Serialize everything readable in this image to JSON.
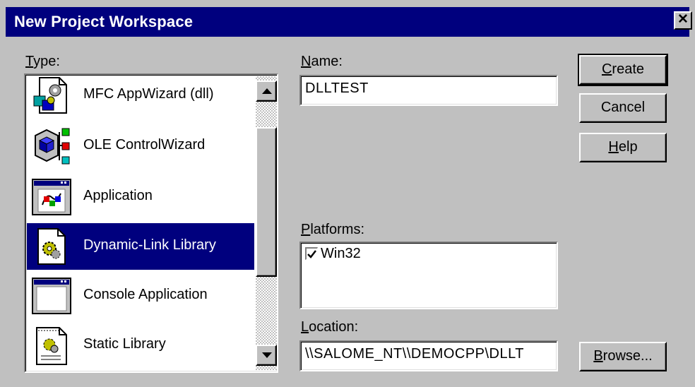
{
  "window": {
    "title": "New Project Workspace",
    "close_glyph": "✕"
  },
  "type_label": {
    "accel": "T",
    "rest": "ype:"
  },
  "type_list": {
    "items": [
      {
        "label": "MFC AppWizard (dll)",
        "icon": "mfc-appwizard-icon",
        "selected": false
      },
      {
        "label": "OLE ControlWizard",
        "icon": "ole-controlwizard-icon",
        "selected": false
      },
      {
        "label": "Application",
        "icon": "application-window-icon",
        "selected": false
      },
      {
        "label": "Dynamic-Link Library",
        "icon": "dll-gear-document-icon",
        "selected": true
      },
      {
        "label": "Console Application",
        "icon": "console-window-icon",
        "selected": false
      },
      {
        "label": "Static Library",
        "icon": "static-library-document-icon",
        "selected": false
      }
    ]
  },
  "name": {
    "accel": "N",
    "rest": "ame:",
    "value": "DLLTEST"
  },
  "platforms": {
    "accel": "P",
    "rest": "latforms:",
    "items": [
      {
        "label": "Win32",
        "checked": true
      }
    ]
  },
  "location": {
    "accel": "L",
    "rest": "ocation:",
    "value": "\\\\SALOME_NT\\\\DEMOCPP\\DLLT"
  },
  "buttons": {
    "create": {
      "accel": "C",
      "rest": "reate"
    },
    "cancel": {
      "label": "Cancel"
    },
    "help": {
      "accel": "H",
      "rest": "elp"
    },
    "browse": {
      "accel": "B",
      "rest": "rowse..."
    }
  },
  "colors": {
    "face": "#c0c0c0",
    "titlebar": "#00007e",
    "selection": "#00007e"
  }
}
